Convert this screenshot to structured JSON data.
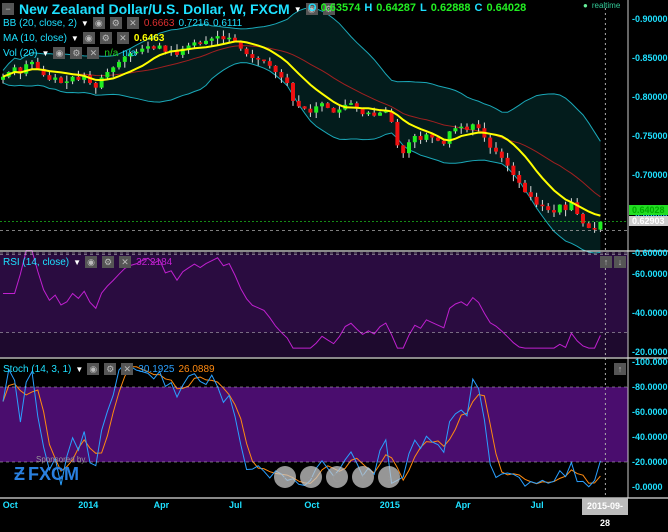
{
  "header": {
    "title": "New Zealand Dollar/U.S. Dollar, W, FXCM",
    "o_label": "O",
    "o": "0.63574",
    "h_label": "H",
    "h": "0.64287",
    "l_label": "L",
    "l": "0.62888",
    "c_label": "C",
    "c": "0.64028",
    "realtime": "realtime"
  },
  "indicators": {
    "bb": {
      "label": "BB (20, close, 2)",
      "mid": "0.6663",
      "upper": "0.7216",
      "lower": "0.6111"
    },
    "ma": {
      "label": "MA (10, close)",
      "value": "0.6463"
    },
    "vol": {
      "label": "Vol (20)",
      "v1": "n/a",
      "v2": "n/a"
    },
    "rsi": {
      "label": "RSI (14, close)",
      "value": "32.2184"
    },
    "stoch": {
      "label": "Stoch (14, 3, 1)",
      "k": "30.1925",
      "d": "26.0889"
    }
  },
  "price_axis": [
    "0.90000",
    "0.85000",
    "0.80000",
    "0.75000",
    "0.70000",
    "0.65000",
    "0.60000"
  ],
  "current_price": "0.64028",
  "crosshair_price": "0.62903",
  "rsi_axis": [
    "60.0000",
    "40.0000",
    "20.0000"
  ],
  "stoch_axis": [
    "100.0000",
    "80.0000",
    "60.0000",
    "40.0000",
    "20.0000",
    "0.0000"
  ],
  "time_axis": [
    {
      "label": "Oct",
      "week": 1
    },
    {
      "label": "2014",
      "week": 14
    },
    {
      "label": "Apr",
      "week": 27
    },
    {
      "label": "Jul",
      "week": 40
    },
    {
      "label": "Oct",
      "week": 53
    },
    {
      "label": "2015",
      "week": 66
    },
    {
      "label": "Apr",
      "week": 79
    },
    {
      "label": "Jul",
      "week": 92
    }
  ],
  "crosshair_date": "2015-09-28",
  "sponsor": {
    "text": "Sponsored by",
    "brand": "FXCM"
  },
  "nav": {
    "prev": "‹",
    "zoom_out": "−",
    "reset": "C",
    "zoom_in": "+",
    "next": "›"
  },
  "colors": {
    "up": "#22ee22",
    "down": "#ee1111",
    "ma": "#ffff00",
    "bb_band": "#1aa8b8",
    "bb_mid": "#a02020",
    "rsi": "#c020d0",
    "stoch_k": "#2aa0ff",
    "stoch_d": "#ff8a10"
  },
  "chart_data": {
    "type": "candlestick",
    "title": "New Zealand Dollar/U.S. Dollar, W, FXCM",
    "ylim": [
      0.59,
      0.92
    ],
    "closes": [
      0.826,
      0.832,
      0.838,
      0.83,
      0.842,
      0.845,
      0.836,
      0.828,
      0.822,
      0.825,
      0.818,
      0.82,
      0.826,
      0.822,
      0.828,
      0.818,
      0.812,
      0.825,
      0.832,
      0.838,
      0.845,
      0.852,
      0.856,
      0.858,
      0.862,
      0.865,
      0.862,
      0.866,
      0.858,
      0.86,
      0.854,
      0.862,
      0.866,
      0.87,
      0.868,
      0.872,
      0.875,
      0.878,
      0.874,
      0.876,
      0.87,
      0.862,
      0.855,
      0.85,
      0.848,
      0.846,
      0.84,
      0.832,
      0.825,
      0.818,
      0.795,
      0.788,
      0.785,
      0.78,
      0.788,
      0.792,
      0.786,
      0.78,
      0.784,
      0.79,
      0.792,
      0.785,
      0.778,
      0.78,
      0.776,
      0.78,
      0.782,
      0.768,
      0.738,
      0.728,
      0.742,
      0.75,
      0.745,
      0.752,
      0.748,
      0.744,
      0.74,
      0.756,
      0.76,
      0.762,
      0.758,
      0.765,
      0.76,
      0.748,
      0.735,
      0.73,
      0.722,
      0.712,
      0.7,
      0.69,
      0.678,
      0.672,
      0.662,
      0.66,
      0.655,
      0.652,
      0.662,
      0.655,
      0.665,
      0.65,
      0.638,
      0.632,
      0.63,
      0.64
    ]
  }
}
